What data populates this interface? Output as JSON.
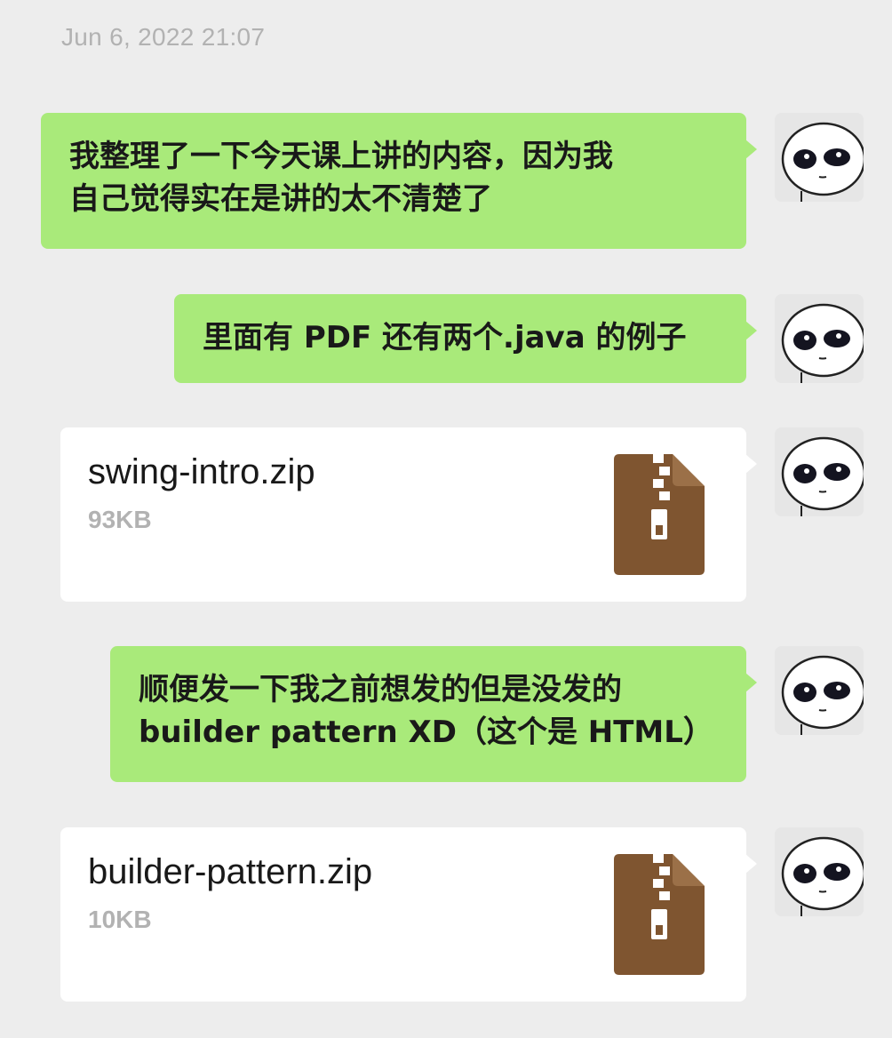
{
  "timestamp": "Jun 6, 2022 21:07",
  "messages": [
    {
      "type": "text",
      "lines": [
        "我整理了一下今天课上讲的内容，因为我",
        "自己觉得实在是讲的太不清楚了"
      ]
    },
    {
      "type": "text",
      "lines": [
        "里面有 PDF 还有两个.java 的例子"
      ]
    },
    {
      "type": "file",
      "name": "swing-intro.zip",
      "size": "93KB"
    },
    {
      "type": "text",
      "lines": [
        "顺便发一下我之前想发的但是没发的",
        "builder pattern XD（这个是 HTML）"
      ]
    },
    {
      "type": "file",
      "name": "builder-pattern.zip",
      "size": "10KB"
    }
  ],
  "colors": {
    "background": "#ededed",
    "bubble": "#a9ea7a",
    "file_card": "#ffffff",
    "zip_icon": "#7f5530",
    "timestamp": "#b2b2b2"
  },
  "icons": {
    "file": "zip-file-icon",
    "avatar": "avatar"
  }
}
